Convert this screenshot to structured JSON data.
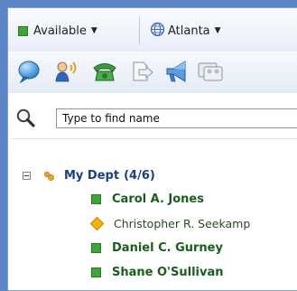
{
  "toolbar": {
    "status_label": "Available",
    "location_label": "Atlanta"
  },
  "iconbar": {
    "icons": [
      "chat-bubble-icon",
      "speaking-person-icon",
      "phone-icon",
      "file-transfer-icon",
      "announcement-icon",
      "conference-icon"
    ]
  },
  "search": {
    "placeholder": "Type to find name"
  },
  "tree": {
    "group": {
      "name": "My Dept",
      "count": "(4/6)"
    },
    "contacts": [
      {
        "name": "Carol A. Jones",
        "status": "available"
      },
      {
        "name": "Christopher R. Seekamp",
        "status": "away"
      },
      {
        "name": "Daniel C. Gurney",
        "status": "available"
      },
      {
        "name": "Shane O'Sullivan",
        "status": "available"
      }
    ]
  },
  "colors": {
    "background": "#5a86c8",
    "available": "#3ea537",
    "away": "#f4b400",
    "group_text": "#173e87",
    "contact_text": "#17601b"
  }
}
